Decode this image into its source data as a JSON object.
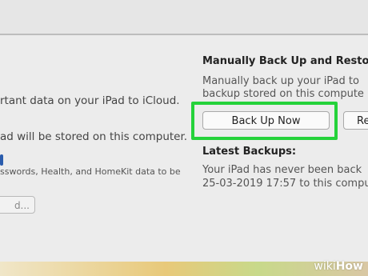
{
  "left": {
    "line1": "rtant data on your iPad to iCloud.",
    "line2": "ad will be stored on this computer.",
    "line3": "sswords, Health, and HomeKit data to be",
    "button_label": "d..."
  },
  "right": {
    "heading": "Manually Back Up and Restore",
    "desc_line1": "Manually back up your iPad to",
    "desc_line2": "backup stored on this compute",
    "backup_button": "Back Up Now",
    "restore_button": "Re",
    "latest_heading": "Latest Backups:",
    "info_line1": "Your iPad has never been back",
    "info_line2": "25-03-2019 17:57 to this compu"
  },
  "watermark": {
    "wiki": "wiki",
    "how": "How"
  },
  "colors": {
    "highlight": "#25d23a",
    "accent_dot": "#2a5cad"
  }
}
